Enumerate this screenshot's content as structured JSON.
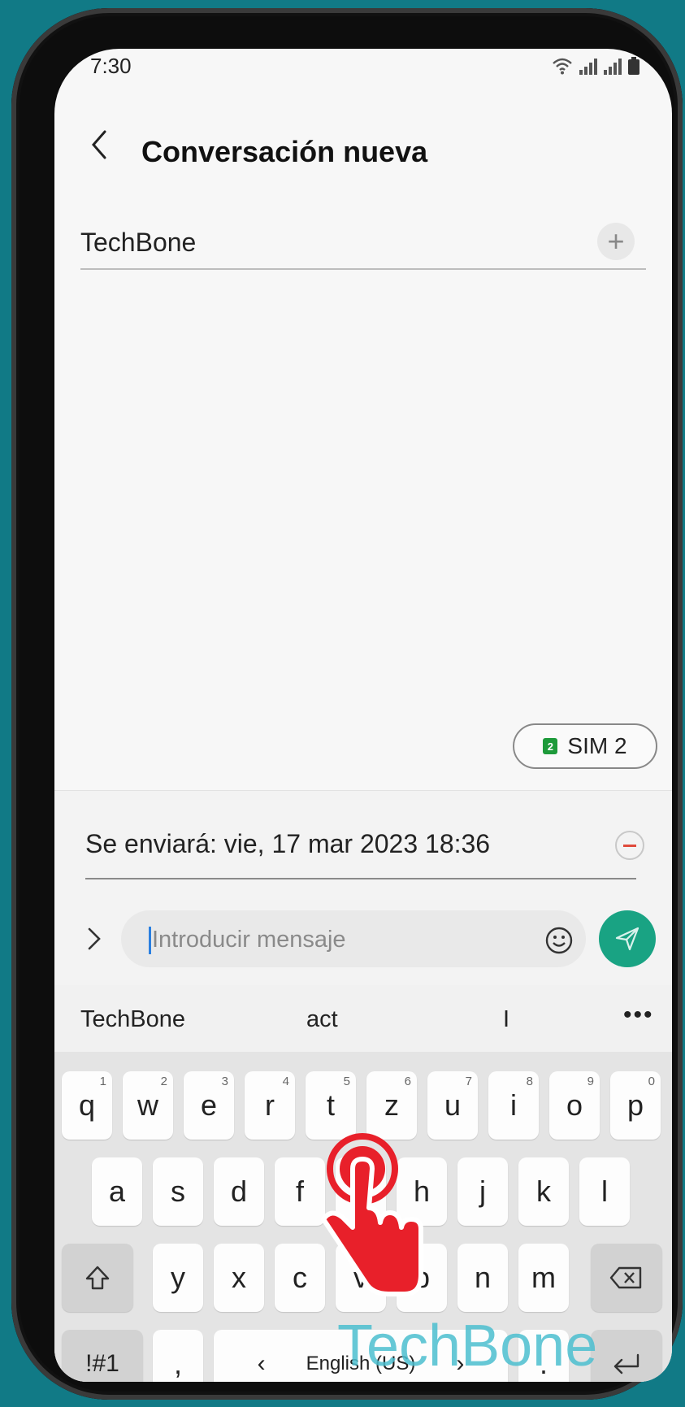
{
  "status_bar": {
    "time": "7:30",
    "icons": [
      "wifi-icon",
      "signal-icon",
      "signal-icon",
      "battery-icon"
    ]
  },
  "header": {
    "title": "Conversación nueva",
    "back_icon": "chevron-left-icon"
  },
  "recipient": {
    "value": "TechBone",
    "add_icon": "plus-icon"
  },
  "sim": {
    "badge": "2",
    "label": "SIM 2",
    "badge_color": "#1d9a3a"
  },
  "schedule": {
    "text": "Se enviará: vie, 17 mar 2023 18:36",
    "remove_icon": "minus-circle-icon"
  },
  "composer": {
    "placeholder": "Introducir mensaje",
    "expand_icon": "chevron-right-icon",
    "emoji_icon": "smiley-icon",
    "send_icon": "send-icon",
    "send_color": "#19a383"
  },
  "suggestions": {
    "items": [
      "TechBone",
      "act",
      "I"
    ],
    "more": "•••"
  },
  "keyboard": {
    "row1": [
      {
        "label": "q",
        "num": "1"
      },
      {
        "label": "w",
        "num": "2"
      },
      {
        "label": "e",
        "num": "3"
      },
      {
        "label": "r",
        "num": "4"
      },
      {
        "label": "t",
        "num": "5"
      },
      {
        "label": "z",
        "num": "6"
      },
      {
        "label": "u",
        "num": "7"
      },
      {
        "label": "i",
        "num": "8"
      },
      {
        "label": "o",
        "num": "9"
      },
      {
        "label": "p",
        "num": "0"
      }
    ],
    "row2": [
      "a",
      "s",
      "d",
      "f",
      "g",
      "h",
      "j",
      "k",
      "l"
    ],
    "row3": [
      "y",
      "x",
      "c",
      "v",
      "b",
      "n",
      "m"
    ],
    "symbols": "!#1",
    "comma": ",",
    "space_label": "English (US)",
    "lang_prev": "‹",
    "lang_next": "›",
    "period": ".",
    "shift_icon": "shift-icon",
    "backspace_icon": "backspace-icon",
    "enter_icon": "enter-icon"
  },
  "overlay": {
    "watermark": "TechBone",
    "tap_icon": "tap-hand-icon",
    "tap_color": "#e8202a"
  }
}
